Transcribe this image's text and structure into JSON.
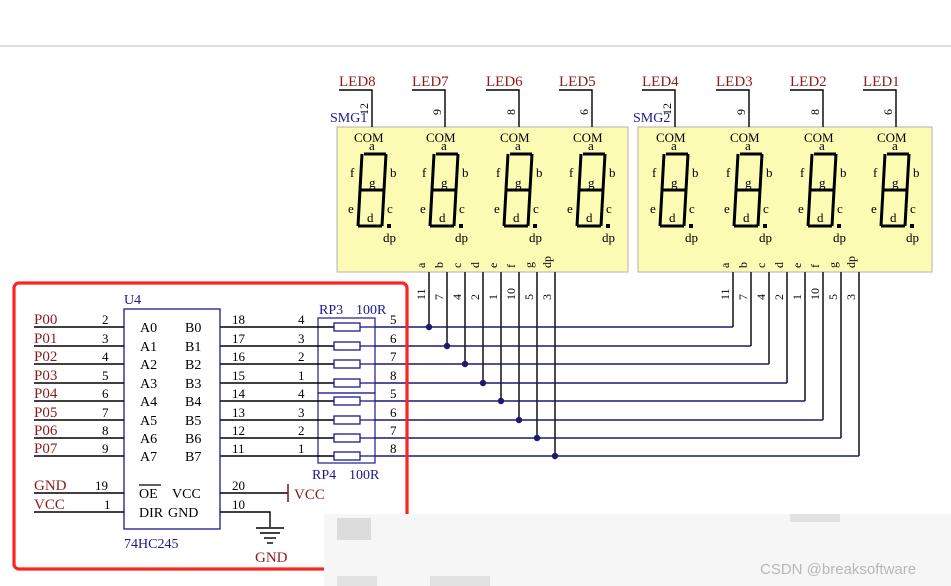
{
  "smg1": {
    "designator": "SMG1",
    "leds": [
      {
        "label": "LED8",
        "pin": "12"
      },
      {
        "label": "LED7",
        "pin": "9"
      },
      {
        "label": "LED6",
        "pin": "8"
      },
      {
        "label": "LED5",
        "pin": "6"
      }
    ]
  },
  "smg2": {
    "designator": "SMG2",
    "leds": [
      {
        "label": "LED4",
        "pin": "12"
      },
      {
        "label": "LED3",
        "pin": "9"
      },
      {
        "label": "LED2",
        "pin": "8"
      },
      {
        "label": "LED1",
        "pin": "6"
      }
    ]
  },
  "digit_labels": {
    "com": "COM",
    "a": "a",
    "b": "b",
    "c": "c",
    "d": "d",
    "e": "e",
    "f": "f",
    "g": "g",
    "dp": "dp"
  },
  "segment_pins": {
    "names": [
      "a",
      "b",
      "c",
      "d",
      "e",
      "f",
      "g",
      "dp"
    ],
    "numbers": [
      "11",
      "7",
      "4",
      "2",
      "1",
      "10",
      "5",
      "3"
    ]
  },
  "u4": {
    "designator": "U4",
    "part": "74HC245",
    "a_names": [
      "A0",
      "A1",
      "A2",
      "A3",
      "A4",
      "A5",
      "A6",
      "A7"
    ],
    "a_pins": [
      "2",
      "3",
      "4",
      "5",
      "6",
      "7",
      "8",
      "9"
    ],
    "nets": [
      "P00",
      "P01",
      "P02",
      "P03",
      "P04",
      "P05",
      "P06",
      "P07"
    ],
    "b_names": [
      "B0",
      "B1",
      "B2",
      "B3",
      "B4",
      "B5",
      "B6",
      "B7"
    ],
    "b_pins": [
      "18",
      "17",
      "16",
      "15",
      "14",
      "13",
      "12",
      "11"
    ],
    "oe": "OE",
    "oe_pin": "19",
    "oe_net": "GND",
    "dir": "DIR",
    "dir_pin": "1",
    "dir_net": "VCC",
    "vcc": "VCC",
    "vcc_pin": "20",
    "vcc_net": "VCC",
    "gnd": "GND",
    "gnd_pin": "10",
    "gnd_net": "GND"
  },
  "rp3": {
    "designator": "RP3",
    "value": "100R",
    "left_pins": [
      "4",
      "3",
      "2",
      "1"
    ],
    "right_pins": [
      "5",
      "6",
      "7",
      "8"
    ]
  },
  "rp4": {
    "designator": "RP4",
    "value": "100R",
    "left_pins": [
      "4",
      "3",
      "2",
      "1"
    ],
    "right_pins": [
      "5",
      "6",
      "7",
      "8"
    ]
  },
  "watermark": "CSDN @breaksoftware",
  "colors": {
    "display_fill": "#fbfbb3",
    "highlight": "#ff2222",
    "net_text": "#8b1a1a",
    "designator_blue": "#1a1a8c"
  }
}
